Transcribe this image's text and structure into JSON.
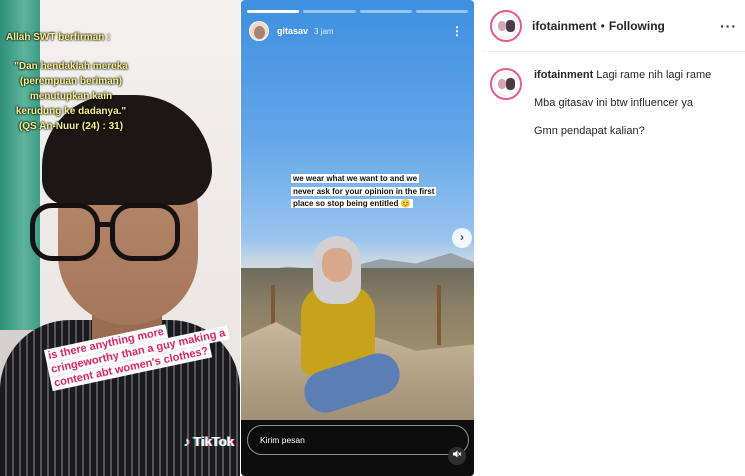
{
  "tiktok": {
    "quote_title": "Allah SWT berfirman :",
    "quote_body": "\"Dan hendaklah mereka (perempuan beriman) menutupkan kain kerudung ke dadanya.\" (QS An-Nuur (24) : 31)",
    "caption": "is there anything more cringeworthy than a guy making a content abt women's clothes?",
    "logo_label": "TikTok"
  },
  "story": {
    "username": "gitasav",
    "time": "3 jam",
    "more_icon": "more-vertical-icon",
    "progress": {
      "segments": 4,
      "completed": 1
    },
    "text": "we wear what we want to and we never ask for your opinion in the first place so stop being entitled 😊",
    "reply_placeholder": "Kirim pesan",
    "mute_icon": "speaker-muted-icon",
    "next_icon": "chevron-right-icon"
  },
  "instagram": {
    "header": {
      "username": "ifotainment",
      "separator": "•",
      "follow_status": "Following",
      "more_label": "···"
    },
    "caption": {
      "username": "ifotainment",
      "lines": [
        "Lagi rame nih lagi rame",
        "Mba gitasav ini btw influencer ya",
        "Gmn pendapat kalian?"
      ]
    },
    "accent_color": "#e85a87"
  }
}
